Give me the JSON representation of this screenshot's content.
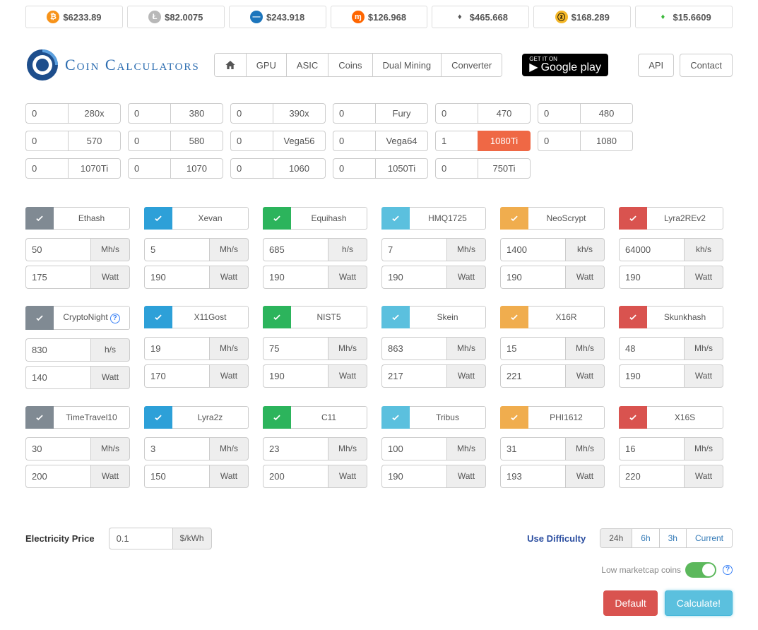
{
  "tickers": [
    {
      "symbol": "BTC",
      "price": "$6233.89",
      "bg": "#f7931a",
      "glyph": "₿"
    },
    {
      "symbol": "LTC",
      "price": "$82.0075",
      "bg": "#b8b8b8",
      "glyph": "Ł"
    },
    {
      "symbol": "DASH",
      "price": "$243.918",
      "bg": "#1c75bc",
      "glyph": "—"
    },
    {
      "symbol": "XMR",
      "price": "$126.968",
      "bg": "#ff6600",
      "glyph": "ɱ"
    },
    {
      "symbol": "ETH",
      "price": "$465.668",
      "bg": "#fff",
      "glyph": "♦",
      "fg": "#555"
    },
    {
      "symbol": "ZEC",
      "price": "$168.289",
      "bg": "#f4b728",
      "glyph": "ⓩ",
      "fg": "#000"
    },
    {
      "symbol": "ETC",
      "price": "$15.6609",
      "bg": "#fff",
      "glyph": "♦",
      "fg": "#3ab83a"
    }
  ],
  "logo_text": "Coin Calculators",
  "nav": [
    "GPU",
    "ASIC",
    "Coins",
    "Dual Mining",
    "Converter"
  ],
  "gp_small": "GET IT ON",
  "gp_big": "Google play",
  "right_nav": {
    "api": "API",
    "contact": "Contact"
  },
  "gpus": [
    {
      "qty": "0",
      "label": "280x"
    },
    {
      "qty": "0",
      "label": "380"
    },
    {
      "qty": "0",
      "label": "390x"
    },
    {
      "qty": "0",
      "label": "Fury"
    },
    {
      "qty": "0",
      "label": "470"
    },
    {
      "qty": "0",
      "label": "480"
    },
    {
      "qty": "0",
      "label": "570"
    },
    {
      "qty": "0",
      "label": "580"
    },
    {
      "qty": "0",
      "label": "Vega56"
    },
    {
      "qty": "0",
      "label": "Vega64"
    },
    {
      "qty": "1",
      "label": "1080Ti",
      "active": true
    },
    {
      "qty": "0",
      "label": "1080"
    },
    {
      "qty": "0",
      "label": "1070Ti"
    },
    {
      "qty": "0",
      "label": "1070"
    },
    {
      "qty": "0",
      "label": "1060"
    },
    {
      "qty": "0",
      "label": "1050Ti"
    },
    {
      "qty": "0",
      "label": "750Ti"
    }
  ],
  "algos": [
    {
      "name": "Ethash",
      "color": "#808a93",
      "hash": "50",
      "hunit": "Mh/s",
      "watt": "175"
    },
    {
      "name": "Xevan",
      "color": "#2da0d8",
      "hash": "5",
      "hunit": "Mh/s",
      "watt": "190"
    },
    {
      "name": "Equihash",
      "color": "#2cb45c",
      "hash": "685",
      "hunit": "h/s",
      "watt": "190"
    },
    {
      "name": "HMQ1725",
      "color": "#5bc0de",
      "hash": "7",
      "hunit": "Mh/s",
      "watt": "190"
    },
    {
      "name": "NeoScrypt",
      "color": "#f0ad4e",
      "hash": "1400",
      "hunit": "kh/s",
      "watt": "190"
    },
    {
      "name": "Lyra2REv2",
      "color": "#d9534f",
      "hash": "64000",
      "hunit": "kh/s",
      "watt": "190"
    },
    {
      "name": "CryptoNight",
      "color": "#808a93",
      "hash": "830",
      "hunit": "h/s",
      "watt": "140",
      "help": true
    },
    {
      "name": "X11Gost",
      "color": "#2da0d8",
      "hash": "19",
      "hunit": "Mh/s",
      "watt": "170"
    },
    {
      "name": "NIST5",
      "color": "#2cb45c",
      "hash": "75",
      "hunit": "Mh/s",
      "watt": "190"
    },
    {
      "name": "Skein",
      "color": "#5bc0de",
      "hash": "863",
      "hunit": "Mh/s",
      "watt": "217"
    },
    {
      "name": "X16R",
      "color": "#f0ad4e",
      "hash": "15",
      "hunit": "Mh/s",
      "watt": "221"
    },
    {
      "name": "Skunkhash",
      "color": "#d9534f",
      "hash": "48",
      "hunit": "Mh/s",
      "watt": "190"
    },
    {
      "name": "TimeTravel10",
      "color": "#808a93",
      "hash": "30",
      "hunit": "Mh/s",
      "watt": "200"
    },
    {
      "name": "Lyra2z",
      "color": "#2da0d8",
      "hash": "3",
      "hunit": "Mh/s",
      "watt": "150"
    },
    {
      "name": "C11",
      "color": "#2cb45c",
      "hash": "23",
      "hunit": "Mh/s",
      "watt": "200"
    },
    {
      "name": "Tribus",
      "color": "#5bc0de",
      "hash": "100",
      "hunit": "Mh/s",
      "watt": "190"
    },
    {
      "name": "PHI1612",
      "color": "#f0ad4e",
      "hash": "31",
      "hunit": "Mh/s",
      "watt": "193"
    },
    {
      "name": "X16S",
      "color": "#d9534f",
      "hash": "16",
      "hunit": "Mh/s",
      "watt": "220"
    }
  ],
  "watt_unit": "Watt",
  "elec": {
    "label": "Electricity Price",
    "value": "0.1",
    "unit": "$/kWh"
  },
  "difficulty": {
    "label": "Use Difficulty",
    "options": [
      "24h",
      "6h",
      "3h",
      "Current"
    ],
    "active": "24h"
  },
  "toggle_label": "Low marketcap coins",
  "buttons": {
    "default": "Default",
    "calculate": "Calculate!"
  }
}
